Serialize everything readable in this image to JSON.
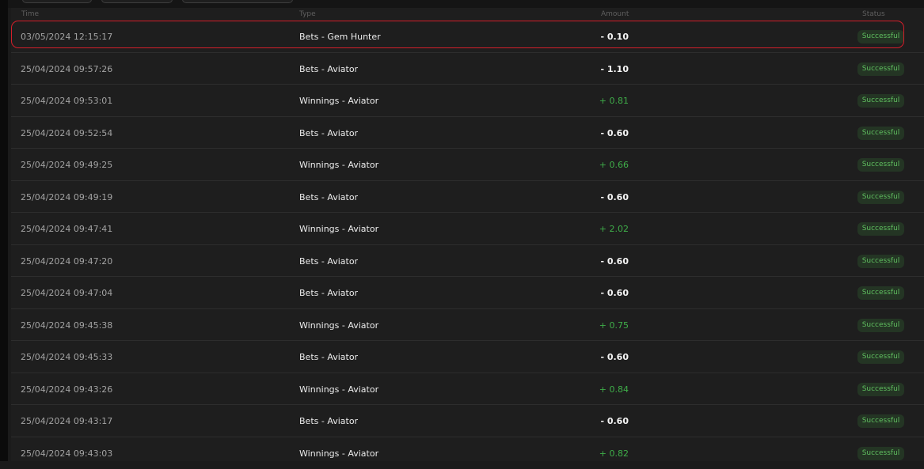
{
  "table": {
    "headers": {
      "time": "Time",
      "type": "Type",
      "amount": "Amount",
      "status": "Status"
    },
    "rows": [
      {
        "time": "03/05/2024 12:15:17",
        "type": "Bets - Gem Hunter",
        "amount": "- 0.10",
        "status": "Successful"
      },
      {
        "time": "25/04/2024 09:57:26",
        "type": "Bets - Aviator",
        "amount": "- 1.10",
        "status": "Successful"
      },
      {
        "time": "25/04/2024 09:53:01",
        "type": "Winnings - Aviator",
        "amount": "+ 0.81",
        "status": "Successful"
      },
      {
        "time": "25/04/2024 09:52:54",
        "type": "Bets - Aviator",
        "amount": "- 0.60",
        "status": "Successful"
      },
      {
        "time": "25/04/2024 09:49:25",
        "type": "Winnings - Aviator",
        "amount": "+ 0.66",
        "status": "Successful"
      },
      {
        "time": "25/04/2024 09:49:19",
        "type": "Bets - Aviator",
        "amount": "- 0.60",
        "status": "Successful"
      },
      {
        "time": "25/04/2024 09:47:41",
        "type": "Winnings - Aviator",
        "amount": "+ 2.02",
        "status": "Successful"
      },
      {
        "time": "25/04/2024 09:47:20",
        "type": "Bets - Aviator",
        "amount": "- 0.60",
        "status": "Successful"
      },
      {
        "time": "25/04/2024 09:47:04",
        "type": "Bets - Aviator",
        "amount": "- 0.60",
        "status": "Successful"
      },
      {
        "time": "25/04/2024 09:45:38",
        "type": "Winnings - Aviator",
        "amount": "+ 0.75",
        "status": "Successful"
      },
      {
        "time": "25/04/2024 09:45:33",
        "type": "Bets - Aviator",
        "amount": "- 0.60",
        "status": "Successful"
      },
      {
        "time": "25/04/2024 09:43:26",
        "type": "Winnings - Aviator",
        "amount": "+ 0.84",
        "status": "Successful"
      },
      {
        "time": "25/04/2024 09:43:17",
        "type": "Bets - Aviator",
        "amount": "- 0.60",
        "status": "Successful"
      },
      {
        "time": "25/04/2024 09:43:03",
        "type": "Winnings - Aviator",
        "amount": "+ 0.82",
        "status": "Successful"
      }
    ]
  },
  "colors": {
    "negative_amount": "#f5f5f5",
    "positive_amount": "#3fae49",
    "status_badge_bg": "#243524",
    "status_badge_text": "#5fbe5f",
    "highlight_outline": "#d41f2a"
  }
}
